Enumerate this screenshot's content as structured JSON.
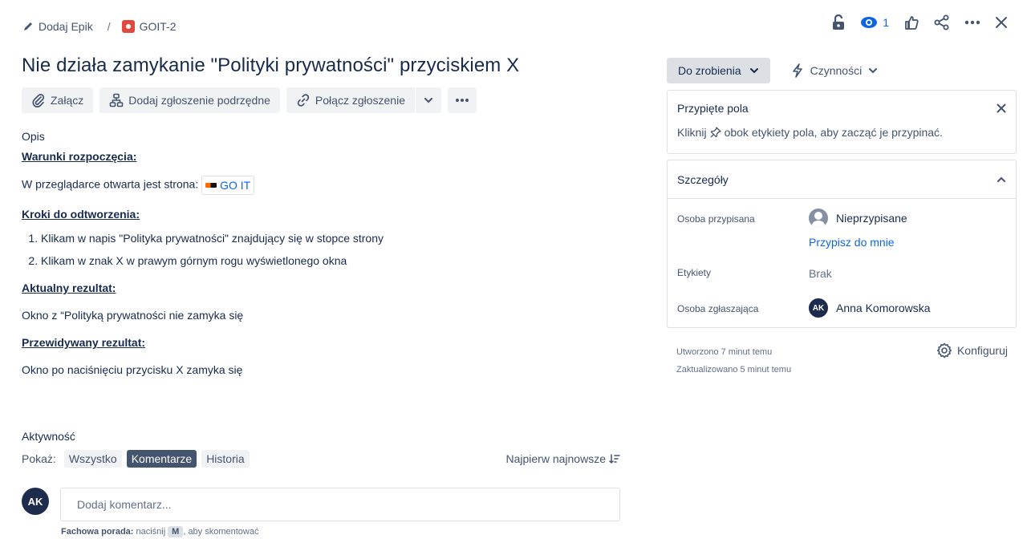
{
  "breadcrumb": {
    "add_epic": "Dodaj Epik",
    "separator": "/",
    "issue_key": "GOIT-2"
  },
  "top_actions": {
    "watchers_count": "1"
  },
  "issue": {
    "title": "Nie działa zamykanie \"Polityki prywatności\" przyciskiem X"
  },
  "toolbar": {
    "attach": "Załącz",
    "add_child": "Dodaj zgłoszenie podrzędne",
    "link_issue": "Połącz zgłoszenie"
  },
  "description": {
    "label": "Opis",
    "preconditions_heading": "Warunki rozpoczęcia:",
    "preconditions_text": "W przeglądarce otwarta jest strona:",
    "link_chip": "GO IT",
    "steps_heading": "Kroki do odtworzenia:",
    "steps": [
      "Klikam w napis \"Polityka prywatności\" znajdujący się w stopce strony",
      "Klikam w znak X w prawym górnym rogu wyświetlonego okna"
    ],
    "actual_heading": "Aktualny rezultat:",
    "actual_text": "Okno z “Polityką prywatności nie zamyka się",
    "expected_heading": "Przewidywany rezultat:",
    "expected_text": "Okno po naciśnięciu przycisku X zamyka się"
  },
  "activity": {
    "title": "Aktywność",
    "show_label": "Pokaż:",
    "filters": [
      "Wszystko",
      "Komentarze",
      "Historia"
    ],
    "active_filter": "Komentarze",
    "sort": "Najpierw najnowsze",
    "avatar_initials": "AK",
    "comment_placeholder": "Dodaj komentarz...",
    "tip_bold": "Fachowa porada:",
    "tip_pre": "naciśnij",
    "tip_key": "M",
    "tip_post": ", aby skomentować"
  },
  "status": {
    "current": "Do zrobienia",
    "actions": "Czynności"
  },
  "pinned": {
    "title": "Przypięte pola",
    "text_before": "Kliknij",
    "text_after": "obok etykiety pola, aby zacząć je przypinać."
  },
  "details": {
    "title": "Szczegóły",
    "assignee_label": "Osoba przypisana",
    "assignee_value": "Nieprzypisane",
    "assign_to_me": "Przypisz do mnie",
    "labels_label": "Etykiety",
    "labels_value": "Brak",
    "reporter_label": "Osoba zgłaszająca",
    "reporter_initials": "AK",
    "reporter_value": "Anna Komorowska"
  },
  "meta": {
    "created": "Utworzono 7 minut temu",
    "updated": "Zaktualizowano 5 minut temu",
    "configure": "Konfiguruj"
  },
  "colors": {
    "link": "#0c66e4",
    "text": "#172b4d",
    "bug": "#e2483d",
    "active_pill": "#44546f"
  }
}
